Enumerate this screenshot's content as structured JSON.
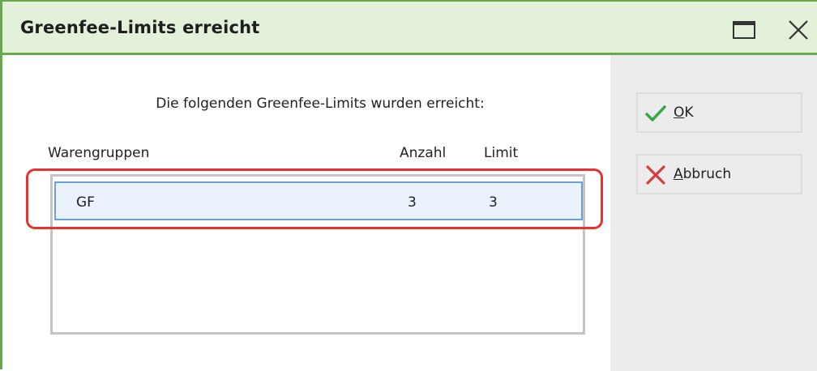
{
  "window": {
    "title": "Greenfee-Limits erreicht"
  },
  "colors": {
    "title_bar_bg": "#e3f0da",
    "title_bar_border": "#6aa84f",
    "selection_border": "#6a9fd8",
    "annotation_red": "#e8322e",
    "ok_check": "#3aa84a",
    "cancel_x": "#d83b3b"
  },
  "icons": {
    "maximize": "window-maximize-icon",
    "close": "close-icon",
    "ok": "checkmark-icon",
    "cancel": "x-mark-icon"
  },
  "dialog": {
    "message": "Die folgenden Greenfee-Limits wurden erreicht:",
    "columns": {
      "warengruppen": "Warengruppen",
      "anzahl": "Anzahl",
      "limit": "Limit"
    },
    "rows": [
      {
        "warengruppe": "GF",
        "anzahl": "3",
        "limit": "3",
        "selected": true
      }
    ]
  },
  "buttons": {
    "ok": {
      "mnemonic": "O",
      "rest": "K"
    },
    "cancel": {
      "mnemonic": "A",
      "rest": "bbruch"
    }
  }
}
